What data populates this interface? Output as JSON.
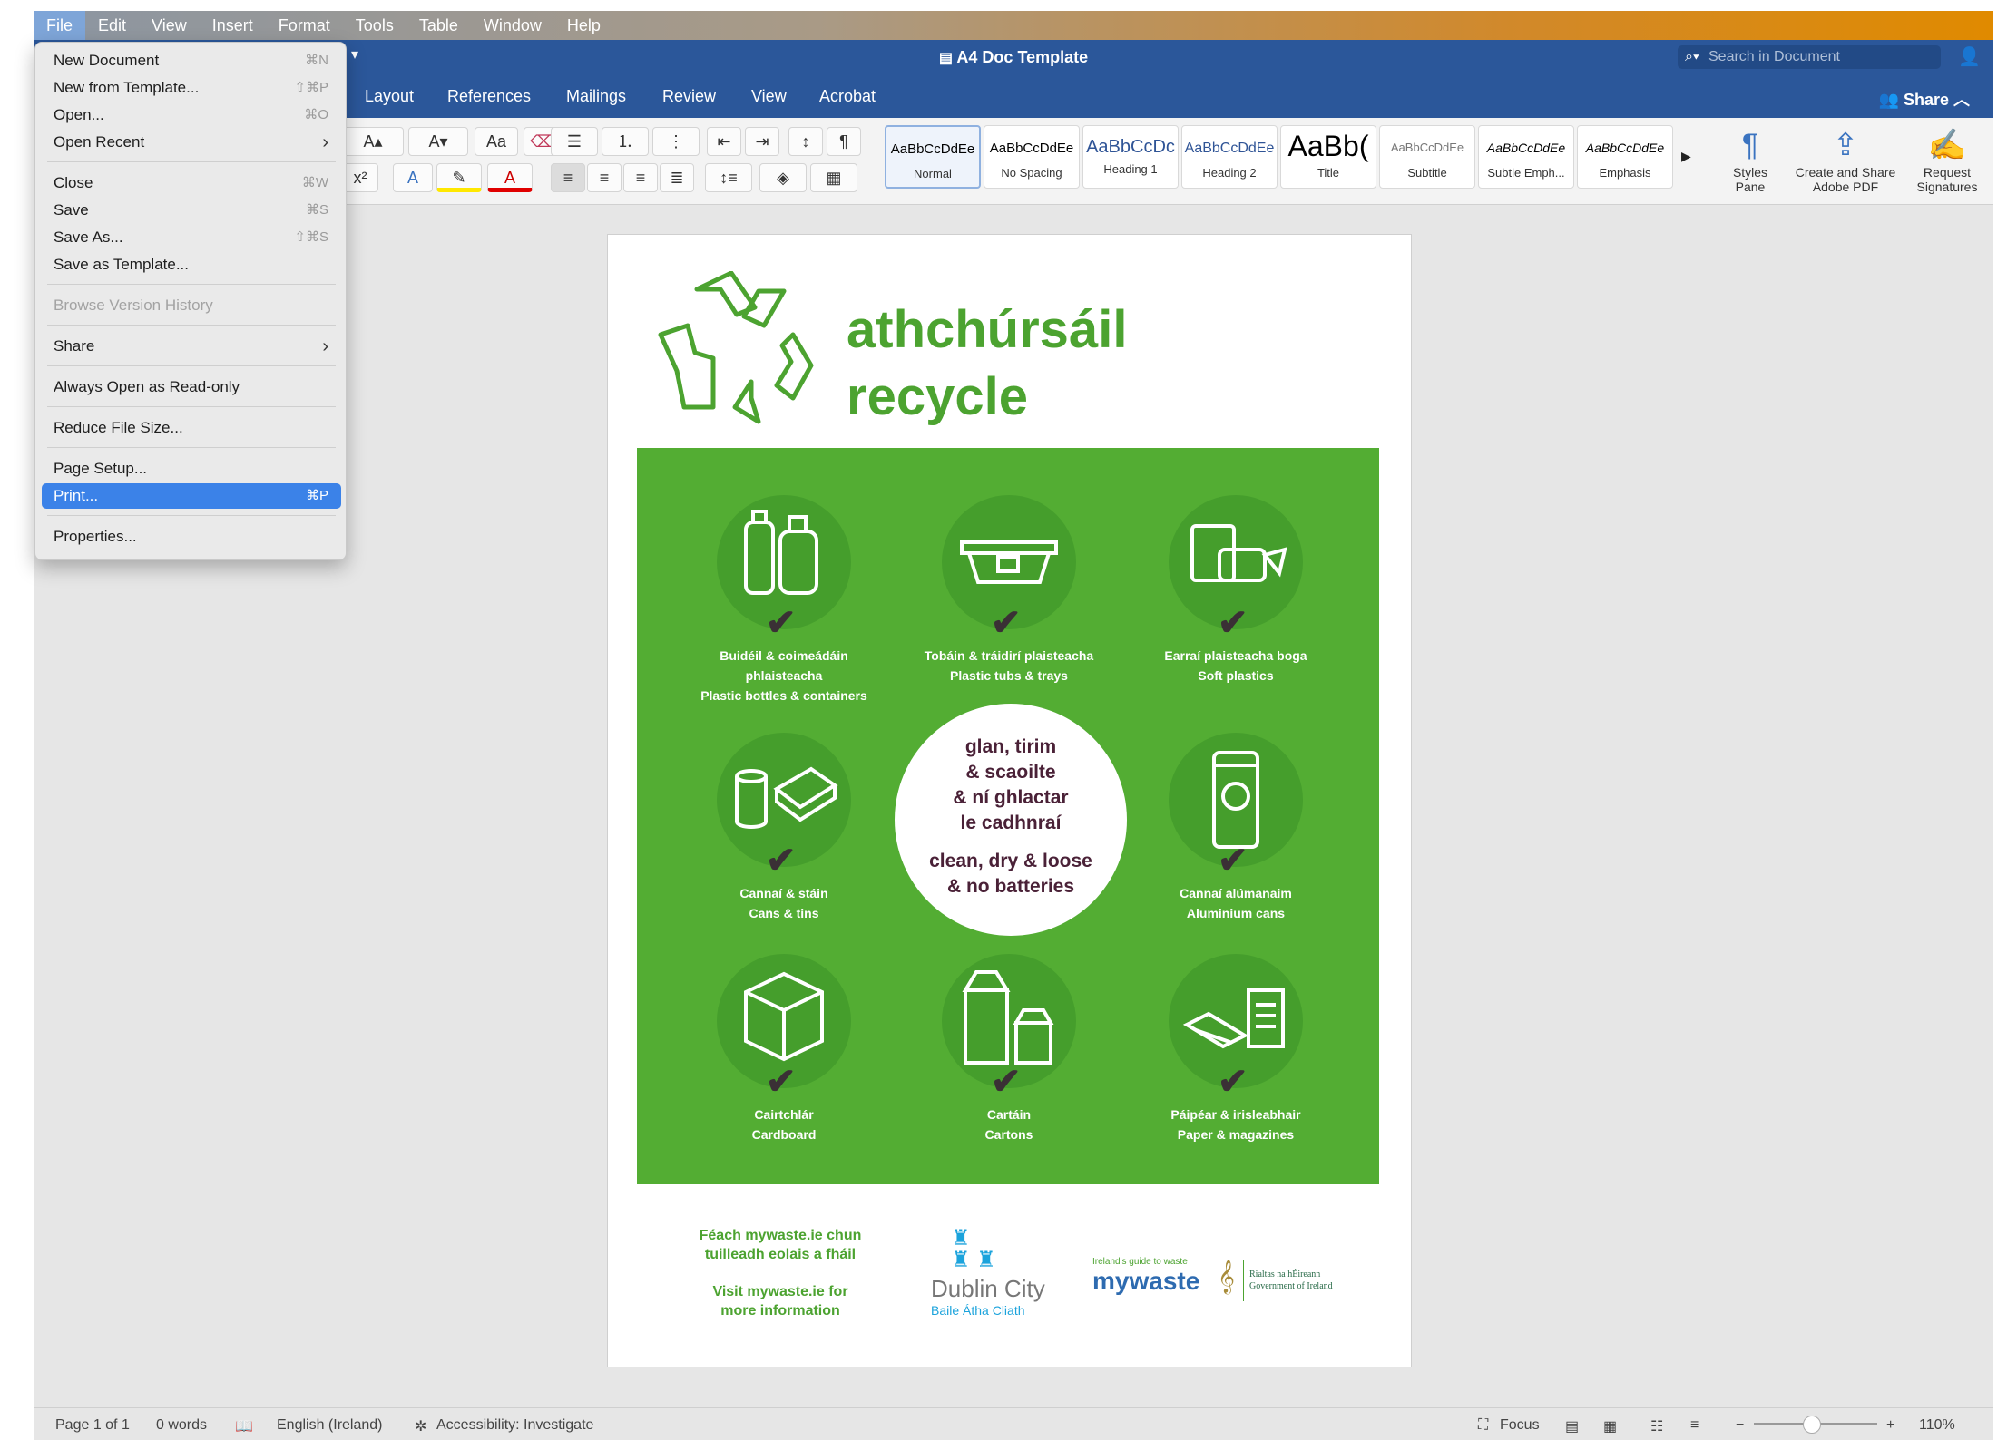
{
  "menubar": {
    "items": [
      "File",
      "Edit",
      "View",
      "Insert",
      "Format",
      "Tools",
      "Table",
      "Window",
      "Help"
    ]
  },
  "title": "A4 Doc Template",
  "search_placeholder": "Search in Document",
  "ribbon_tabs": [
    "Layout",
    "References",
    "Mailings",
    "Review",
    "View",
    "Acrobat"
  ],
  "share_label": "Share",
  "styles": [
    {
      "preview": "AaBbCcDdEe",
      "name": "Normal"
    },
    {
      "preview": "AaBbCcDdEe",
      "name": "No Spacing"
    },
    {
      "preview": "AaBbCcDc",
      "name": "Heading 1"
    },
    {
      "preview": "AaBbCcDdEe",
      "name": "Heading 2"
    },
    {
      "preview": "AaBb(",
      "name": "Title"
    },
    {
      "preview": "AaBbCcDdEe",
      "name": "Subtitle"
    },
    {
      "preview": "AaBbCcDdEe",
      "name": "Subtle Emph..."
    },
    {
      "preview": "AaBbCcDdEe",
      "name": "Emphasis"
    }
  ],
  "ribbon_buttons": {
    "styles_pane": "Styles\nPane",
    "adobe": "Create and Share\nAdobe PDF",
    "signatures": "Request\nSignatures"
  },
  "file_menu": {
    "new_document": {
      "label": "New Document",
      "shortcut": "⌘N"
    },
    "new_from_template": {
      "label": "New from Template...",
      "shortcut": "⇧⌘P"
    },
    "open": {
      "label": "Open...",
      "shortcut": "⌘O"
    },
    "open_recent": {
      "label": "Open Recent",
      "shortcut": "›"
    },
    "close": {
      "label": "Close",
      "shortcut": "⌘W"
    },
    "save": {
      "label": "Save",
      "shortcut": "⌘S"
    },
    "save_as": {
      "label": "Save As...",
      "shortcut": "⇧⌘S"
    },
    "save_as_template": {
      "label": "Save as Template..."
    },
    "browse_history": {
      "label": "Browse Version History"
    },
    "share": {
      "label": "Share",
      "shortcut": "›"
    },
    "always_read_only": {
      "label": "Always Open as Read-only"
    },
    "reduce_size": {
      "label": "Reduce File Size..."
    },
    "page_setup": {
      "label": "Page Setup..."
    },
    "print": {
      "label": "Print...",
      "shortcut": "⌘P"
    },
    "properties": {
      "label": "Properties..."
    }
  },
  "document": {
    "heading_line1": "athchúrsáil",
    "heading_line2": "recycle",
    "items": [
      {
        "irish": "Buidéil & coimeádáin\nphlaisteacha",
        "english": "Plastic bottles & containers",
        "icon": "bottles-icon"
      },
      {
        "irish": "Tobáin & tráidirí plaisteacha",
        "english": "Plastic tubs & trays",
        "icon": "tub-icon"
      },
      {
        "irish": "Earraí plaisteacha boga",
        "english": "Soft plastics",
        "icon": "soft-plastics-icon"
      },
      {
        "irish": "Cannaí & stáin",
        "english": "Cans & tins",
        "icon": "cans-icon"
      },
      {
        "irish": "Cannaí alúmanaim",
        "english": "Aluminium cans",
        "icon": "aluminium-can-icon"
      },
      {
        "irish": "Cairtchlár",
        "english": "Cardboard",
        "icon": "box-icon"
      },
      {
        "irish": "Cartáin",
        "english": "Cartons",
        "icon": "carton-icon"
      },
      {
        "irish": "Páipéar & irisleabhair",
        "english": "Paper & magazines",
        "icon": "paper-icon"
      }
    ],
    "center_irish": "glan, tirim\n& scaoilte\n& ní ghlactar\nle cadhnraí",
    "center_english": "clean, dry & loose\n& no batteries",
    "footer_irish": "Féach mywaste.ie chun\ntuilleadh eolais a fháil",
    "footer_english": "Visit mywaste.ie for\nmore information",
    "dublin_name": "Dublin City",
    "dublin_irish": "Baile Átha Cliath",
    "mywaste_tagline": "Ireland's guide to waste",
    "mywaste_logo": "mywaste",
    "gov_line1": "Rialtas na hÉireann",
    "gov_line2": "Government of Ireland"
  },
  "status": {
    "page": "Page 1 of 1",
    "words": "0 words",
    "language": "English (Ireland)",
    "accessibility": "Accessibility: Investigate",
    "focus": "Focus",
    "zoom": "110%"
  },
  "colors": {
    "accent": "#2b579a",
    "poster_green": "#53ad33",
    "menu_highlight": "#3b82e8"
  }
}
